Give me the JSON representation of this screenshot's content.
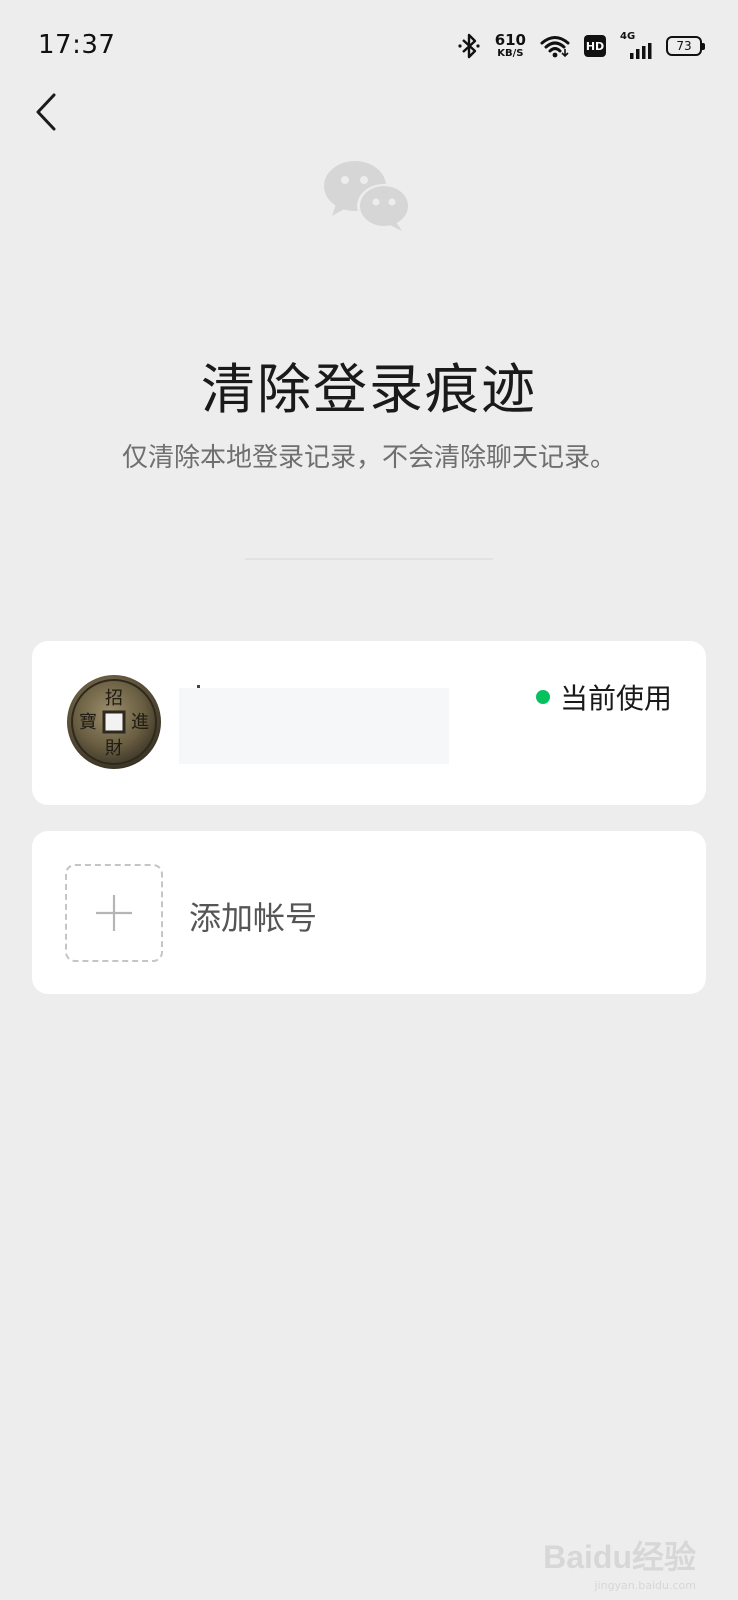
{
  "status_bar": {
    "time": "17:37",
    "net_speed": "610",
    "net_unit": "KB/S",
    "hd_label": "HD",
    "network_type": "4G",
    "battery": "73"
  },
  "header": {
    "title": "清除登录痕迹",
    "subtitle": "仅清除本地登录记录，不会清除聊天记录。"
  },
  "accounts": [
    {
      "avatar_icon": "coin-avatar",
      "status_label": "当前使用",
      "status_color": "#07c160"
    }
  ],
  "add_account": {
    "label": "添加帐号"
  },
  "watermark": {
    "main": "Baidu经验",
    "sub": "jingyan.baidu.com"
  }
}
